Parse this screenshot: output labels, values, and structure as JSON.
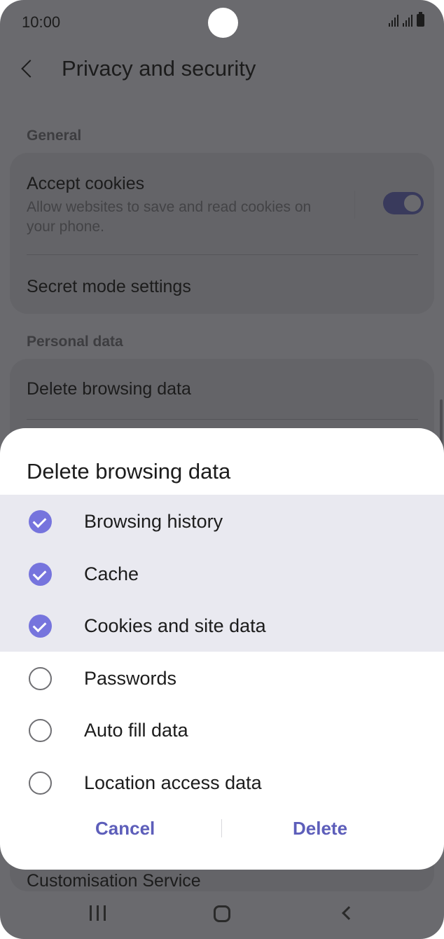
{
  "status_bar": {
    "time": "10:00",
    "signal_icon": "signal-icon",
    "battery_icon": "battery-icon"
  },
  "app_bar": {
    "title": "Privacy and security",
    "back_icon": "chevron-left-icon"
  },
  "sections": {
    "general_label": "General",
    "personal_label": "Personal data"
  },
  "settings": {
    "accept_cookies": {
      "title": "Accept cookies",
      "subtitle": "Allow websites to save and read cookies on your phone.",
      "enabled": true
    },
    "secret_mode": {
      "title": "Secret mode settings"
    },
    "delete_browsing": {
      "title": "Delete browsing data"
    },
    "customisation": {
      "title": "Customisation Service"
    }
  },
  "dialog": {
    "title": "Delete browsing data",
    "options": [
      {
        "label": "Browsing history",
        "checked": true
      },
      {
        "label": "Cache",
        "checked": true
      },
      {
        "label": "Cookies and site data",
        "checked": true
      },
      {
        "label": "Passwords",
        "checked": false
      },
      {
        "label": "Auto fill data",
        "checked": false
      },
      {
        "label": "Location access data",
        "checked": false
      }
    ],
    "cancel_label": "Cancel",
    "delete_label": "Delete"
  },
  "colors": {
    "accent": "#7674dd",
    "button_text": "#5d5eba",
    "selected_row_bg": "#e9e9f0",
    "scrim_bg": "#6a6a6e"
  },
  "nav_bar": {
    "recents_icon": "recents-icon",
    "home_icon": "home-icon",
    "back_icon": "back-icon"
  }
}
